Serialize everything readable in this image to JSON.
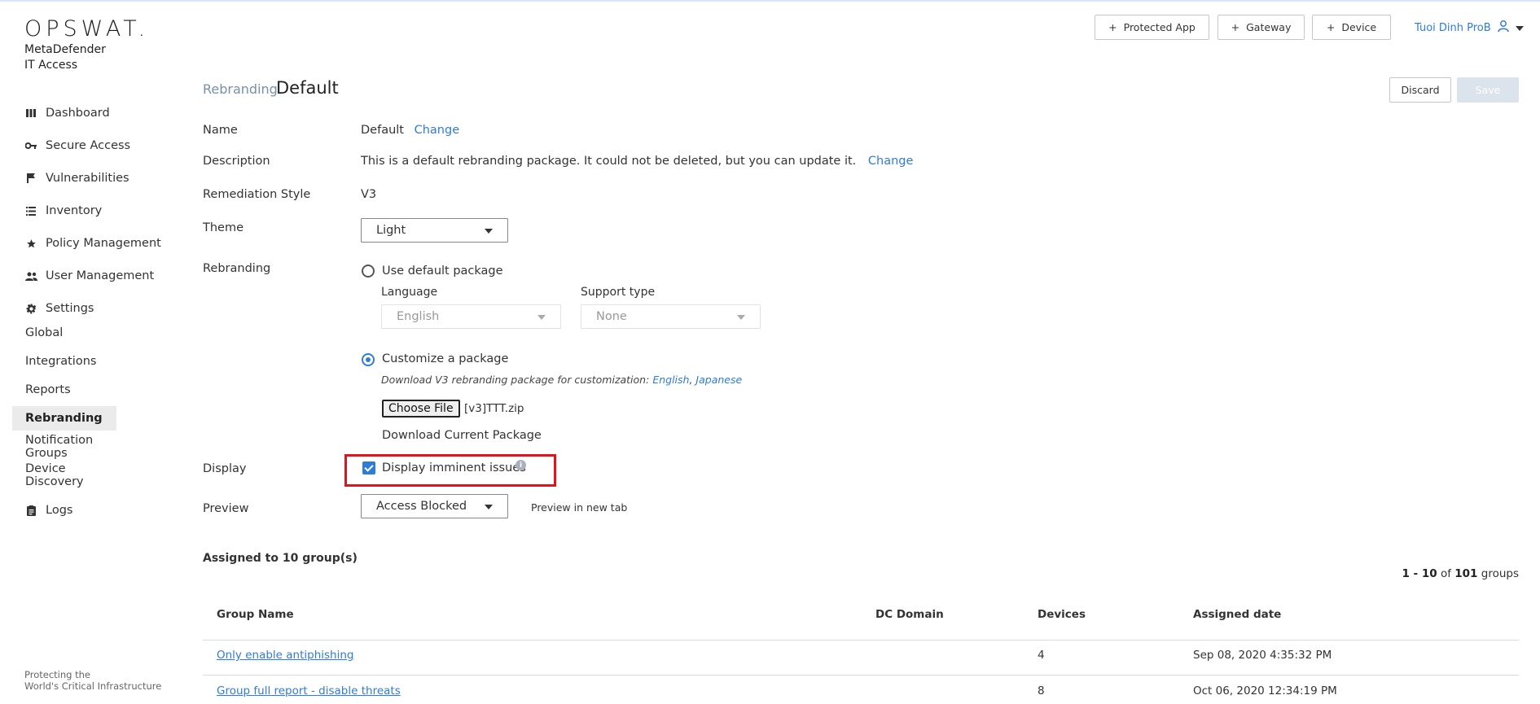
{
  "brand": {
    "logo": "OPSWAT.",
    "product_line1": "MetaDefender",
    "product_line2": "IT Access",
    "footer_line1": "Protecting the",
    "footer_line2": "World's Critical Infrastructure"
  },
  "sidebar": {
    "items": [
      {
        "label": "Dashboard",
        "icon": "bars-icon"
      },
      {
        "label": "Secure Access",
        "icon": "key-icon"
      },
      {
        "label": "Vulnerabilities",
        "icon": "flag-icon"
      },
      {
        "label": "Inventory",
        "icon": "list-icon"
      },
      {
        "label": "Policy Management",
        "icon": "star-icon"
      },
      {
        "label": "User Management",
        "icon": "users-icon"
      },
      {
        "label": "Settings",
        "icon": "gear-icon"
      },
      {
        "label": "Logs",
        "icon": "clipboard-icon"
      }
    ],
    "settings_sub": [
      "Global",
      "Integrations",
      "Reports",
      "Rebranding",
      "Notification Groups",
      "Device Discovery"
    ]
  },
  "header": {
    "protected_app": "Protected App",
    "gateway": "Gateway",
    "device": "Device",
    "user_name": "Tuoi Dinh ProB"
  },
  "page": {
    "breadcrumb": "Rebranding",
    "title": "Default",
    "discard": "Discard",
    "save": "Save"
  },
  "form": {
    "name_label": "Name",
    "name_value": "Default",
    "change": "Change",
    "description_label": "Description",
    "description_value": "This is a default rebranding package. It could not be deleted, but you can update it.",
    "remediation_label": "Remediation Style",
    "remediation_value": "V3",
    "theme_label": "Theme",
    "theme_value": "Light",
    "rebranding_label": "Rebranding",
    "use_default": "Use default package",
    "language_label": "Language",
    "language_value": "English",
    "support_label": "Support type",
    "support_value": "None",
    "customize": "Customize a package",
    "download_hint": "Download V3 rebranding package for customization:",
    "download_english": "English",
    "download_sep": ",",
    "download_japanese": "Japanese",
    "choose_file": "Choose File",
    "file_name": "[v3]TTT.zip",
    "download_current": "Download Current Package",
    "display_label": "Display",
    "display_checkbox": "Display imminent issues",
    "info_glyph": "i",
    "preview_label": "Preview",
    "preview_value": "Access Blocked",
    "preview_new_tab": "Preview in new tab"
  },
  "groups": {
    "assigned": "Assigned to 10 group(s)",
    "pager_range": "1 - 10",
    "pager_of": "of",
    "pager_total": "101",
    "pager_unit": "groups",
    "columns": [
      "Group Name",
      "DC Domain",
      "Devices",
      "Assigned date"
    ],
    "rows": [
      {
        "name": "Only enable antiphishing",
        "domain": "",
        "devices": "4",
        "date": "Sep 08, 2020 4:35:32 PM"
      },
      {
        "name": "Group full report - disable threats",
        "domain": "",
        "devices": "8",
        "date": "Oct 06, 2020 12:34:19 PM"
      }
    ]
  },
  "colors": {
    "accent": "#2f7cd6",
    "highlight": "#e0151b",
    "muted": "#7791aa"
  }
}
